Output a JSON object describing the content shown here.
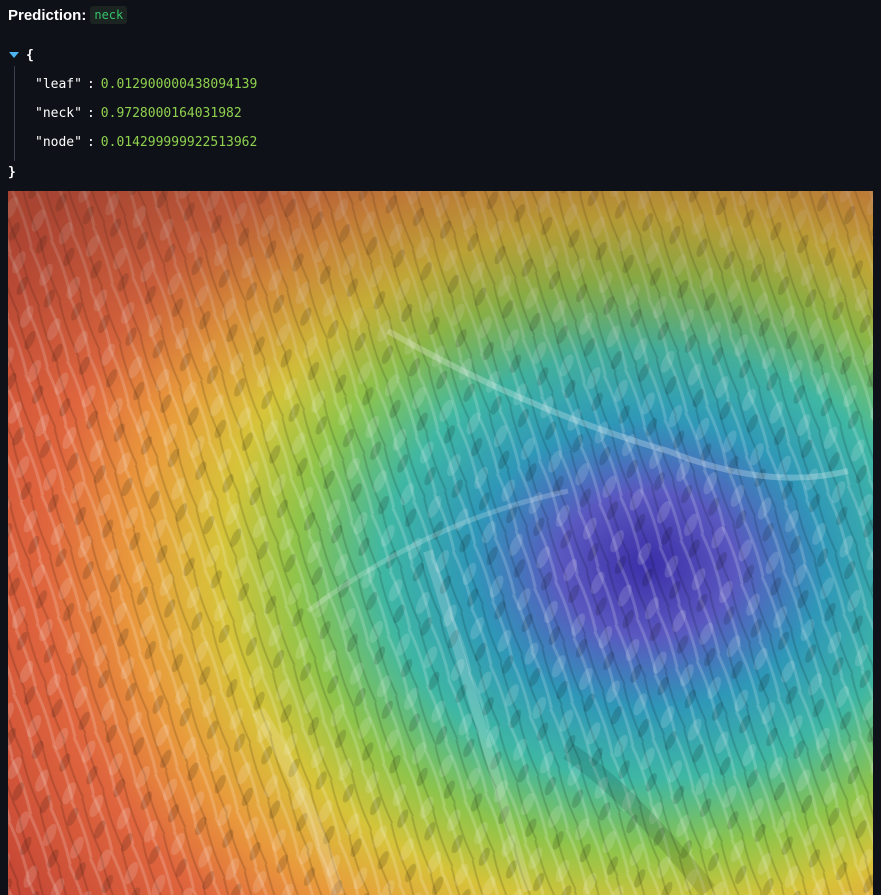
{
  "prediction": {
    "label": "Prediction:",
    "value": "neck"
  },
  "json_viewer": {
    "open_brace": "{",
    "close_brace": "}",
    "entries": [
      {
        "key": "\"leaf\"",
        "value": "0.012900000438094139"
      },
      {
        "key": "\"neck\"",
        "value": "0.9728000164031982"
      },
      {
        "key": "\"node\"",
        "value": "0.014299999922513962"
      }
    ],
    "separator": ":"
  },
  "colors": {
    "background": "#0e1117",
    "badge_text": "#34c36b",
    "number": "#8fd14f",
    "toggle": "#4fb3f0"
  }
}
